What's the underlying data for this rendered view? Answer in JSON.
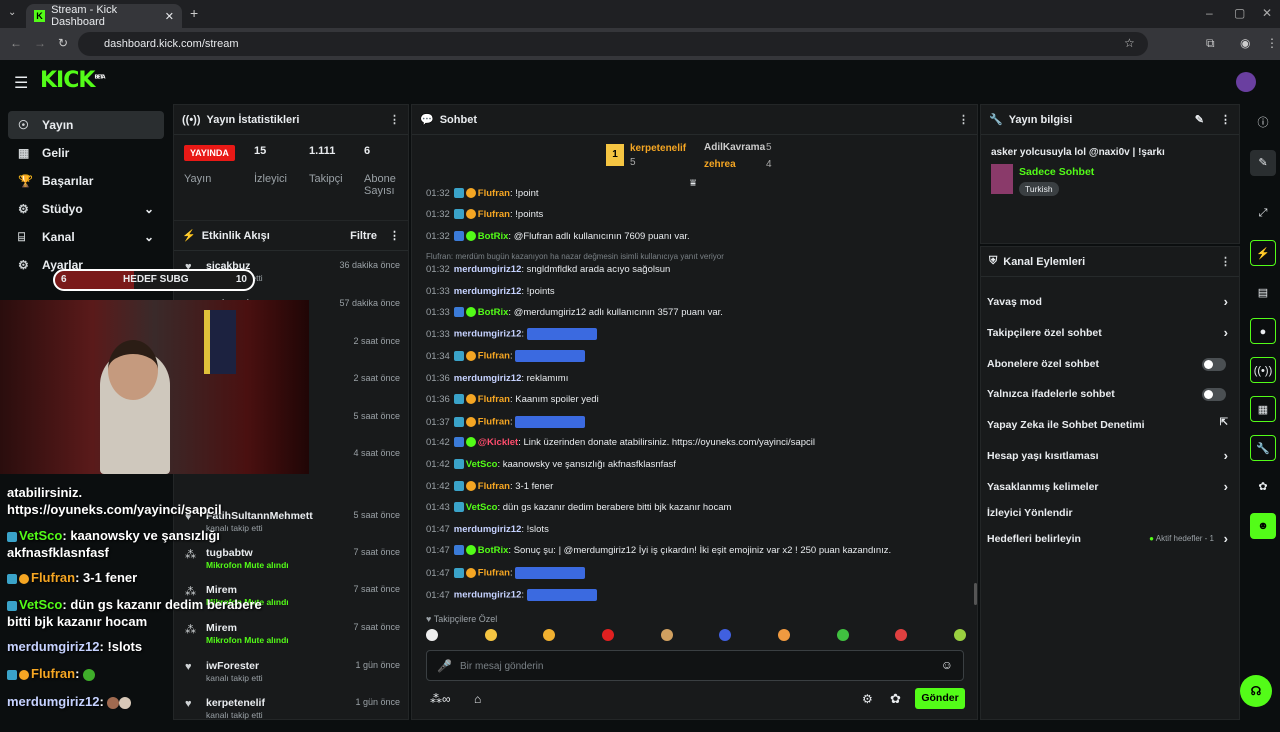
{
  "browser": {
    "tab_title": "Stream - Kick Dashboard",
    "url": "dashboard.kick.com/stream"
  },
  "app": {
    "logo": "KICK",
    "beta": "BETA"
  },
  "nav": [
    {
      "label": "Yayın",
      "icon": "broadcast-icon"
    },
    {
      "label": "Gelir",
      "icon": "wallet-icon"
    },
    {
      "label": "Başarılar",
      "icon": "trophy-icon"
    },
    {
      "label": "Stüdyo",
      "icon": "studio-icon"
    },
    {
      "label": "Kanal",
      "icon": "channel-icon"
    },
    {
      "label": "Ayarlar",
      "icon": "gear-icon"
    }
  ],
  "overlay": {
    "goal_left": "6",
    "goal_label": "HEDEF SUBG",
    "goal_right": "10",
    "lines": [
      "atabilirsiniz.",
      "https://oyuneks.com/yayinci/sapcil",
      "kaanowsky ve şansızlığı",
      "akfnasfklasnfasf",
      "3-1 fener",
      "dün gs kazanır dedim berabere",
      "bitti bjk kazanır hocam",
      "!slots"
    ],
    "users": [
      "VetSco",
      "Flufran",
      "VetSco",
      "merdumgiriz12",
      "Flufran",
      "merdumgiriz12"
    ]
  },
  "stats": {
    "title": "Yayın İstatistikleri",
    "live": "YAYINDA",
    "live_label": "Yayın",
    "viewers": "15",
    "viewers_label": "İzleyici",
    "followers": "1.111",
    "followers_label": "Takipçi",
    "subs": "6",
    "subs_label": "Abone Sayısı"
  },
  "activity": {
    "title": "Etkinlik Akışı",
    "filter": "Filtre",
    "items": [
      {
        "name": "sicakbuz",
        "sub": "kanalı takip etti",
        "time": "36 dakika önce"
      },
      {
        "name": "Trabzonlu_33",
        "sub": "",
        "time": "57 dakika önce"
      },
      {
        "name": "",
        "sub": "",
        "time": "2 saat önce"
      },
      {
        "name": "",
        "sub": "",
        "time": "2 saat önce"
      },
      {
        "name": "",
        "sub": "",
        "time": "5 saat önce"
      },
      {
        "name": "",
        "sub": "gönderdi",
        "time": "4 saat önce"
      },
      {
        "name": "FatihSultannMehmett",
        "sub": "kanalı takip etti",
        "time": "5 saat önce"
      },
      {
        "name": "tugbabtw",
        "sub": "Mikrofon Mute alındı",
        "time": "7 saat önce"
      },
      {
        "name": "Mirem",
        "sub": "Mikrofon Mute alındı",
        "time": "7 saat önce"
      },
      {
        "name": "Mirem",
        "sub": "Mikrofon Mute alındı",
        "time": "7 saat önce"
      },
      {
        "name": "iwForester",
        "sub": "kanalı takip etti",
        "time": "1 gün önce"
      },
      {
        "name": "kerpetenelif",
        "sub": "kanalı takip etti",
        "time": "1 gün önce"
      }
    ]
  },
  "chat": {
    "title": "Sohbet",
    "top1": "kerpetenelif",
    "top1_count": "5",
    "top2": "AdilKavrama",
    "top2_count": "5",
    "top3": "zehrea",
    "top3_count": "4",
    "reply_hint": "Flufran: merdüm bugün kazanıyon ha nazar değmesin isimli kullanıcıya yanıt veriyor",
    "messages": [
      {
        "time": "01:32",
        "user": "Flufran",
        "cls": "u-orange",
        "badge": "sub,y",
        "text": "!point"
      },
      {
        "time": "01:32",
        "user": "Flufran",
        "cls": "u-orange",
        "badge": "sub,y",
        "text": "!points"
      },
      {
        "time": "01:32",
        "user": "BotRix",
        "cls": "u-green",
        "badge": "bl,gr",
        "text": "@Flufran adlı kullanıcının 7609 puanı var."
      },
      {
        "time": "01:32",
        "user": "merdumgiriz12",
        "cls": "u-white",
        "badge": "",
        "text": "sngldmfldkd arada acıyo sağolsun"
      },
      {
        "time": "01:33",
        "user": "merdumgiriz12",
        "cls": "u-white",
        "badge": "",
        "text": "!points"
      },
      {
        "time": "01:33",
        "user": "BotRix",
        "cls": "u-green",
        "badge": "bl,gr",
        "text": "@merdumgiriz12 adlı kullanıcının 3577 puanı var."
      },
      {
        "time": "01:33",
        "user": "merdumgiriz12",
        "cls": "u-white",
        "badge": "",
        "text": ""
      },
      {
        "time": "01:34",
        "user": "Flufran",
        "cls": "u-orange",
        "badge": "sub,y",
        "text": ""
      },
      {
        "time": "01:36",
        "user": "merdumgiriz12",
        "cls": "u-white",
        "badge": "",
        "text": "reklamımı"
      },
      {
        "time": "01:36",
        "user": "Flufran",
        "cls": "u-orange",
        "badge": "sub,y",
        "text": "Kaanım spoiler yedi"
      },
      {
        "time": "01:37",
        "user": "Flufran",
        "cls": "u-orange",
        "badge": "sub,y",
        "text": ""
      },
      {
        "time": "01:42",
        "user": "@Kicklet",
        "cls": "u-red",
        "badge": "bl,gr",
        "text": "Link üzerinden donate atabilirsiniz. https://oyuneks.com/yayinci/sapcil"
      },
      {
        "time": "01:42",
        "user": "VetSco",
        "cls": "u-green",
        "badge": "sub",
        "text": "kaanowsky ve şansızlığı akfnasfklasnfasf"
      },
      {
        "time": "01:42",
        "user": "Flufran",
        "cls": "u-orange",
        "badge": "sub,y",
        "text": "3-1 fener"
      },
      {
        "time": "01:43",
        "user": "VetSco",
        "cls": "u-green",
        "badge": "sub",
        "text": "dün gs kazanır dedim berabere bitti bjk kazanır hocam"
      },
      {
        "time": "01:47",
        "user": "merdumgiriz12",
        "cls": "u-white",
        "badge": "",
        "text": "!slots"
      },
      {
        "time": "01:47",
        "user": "BotRix",
        "cls": "u-green",
        "badge": "bl,gr",
        "text": "Sonuç şu: | @merdumgiriz12 İyi iş çıkardın! İki eşit emojiniz var x2 ! 250 puan kazandınız."
      },
      {
        "time": "01:47",
        "user": "Flufran",
        "cls": "u-orange",
        "badge": "sub,y",
        "text": ""
      },
      {
        "time": "01:47",
        "user": "merdumgiriz12",
        "cls": "u-white",
        "badge": "",
        "text": ""
      }
    ],
    "followers_only": "Takipçilere Özel",
    "placeholder": "Bir mesaj gönderin",
    "send": "Gönder"
  },
  "info": {
    "title": "Yayın bilgisi",
    "stream_title": "asker yolcusuyla lol @naxi0v | !şarkı",
    "category": "Sadece Sohbet",
    "language": "Turkish"
  },
  "actions": {
    "title": "Kanal Eylemleri",
    "items": [
      {
        "label": "Yavaş mod",
        "kind": "arrow"
      },
      {
        "label": "Takipçilere özel sohbet",
        "kind": "arrow"
      },
      {
        "label": "Abonelere özel sohbet",
        "kind": "toggle"
      },
      {
        "label": "Yalnızca ifadelerle sohbet",
        "kind": "toggle"
      },
      {
        "label": "Yapay Zeka ile Sohbet Denetimi",
        "kind": "ext"
      },
      {
        "label": "Hesap yaşı kısıtlaması",
        "kind": "arrow"
      },
      {
        "label": "Yasaklanmış kelimeler",
        "kind": "arrow"
      },
      {
        "label": "İzleyici Yönlendir",
        "kind": "none"
      },
      {
        "label": "Hedefleri belirleyin",
        "kind": "arrow"
      }
    ],
    "goals_hint": "Aktif hedefler - 1"
  },
  "colors": {
    "brand": "#53fc18",
    "live": "#e91916",
    "panel": "#181a1b"
  }
}
